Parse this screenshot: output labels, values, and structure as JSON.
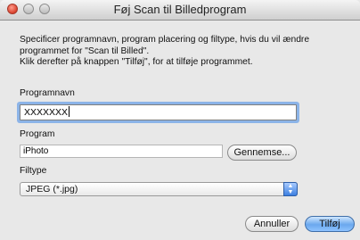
{
  "window": {
    "title": "Føj Scan til Billedprogram"
  },
  "instructions": {
    "line1": "Specificer programnavn, program placering og filtype, hvis du vil ændre",
    "line2": "programmet for \"Scan til Billed\".",
    "line3": "Klik derefter på knappen \"Tilføj\", for at tilføje programmet."
  },
  "program_name": {
    "label": "Programnavn",
    "value": "XXXXXXX"
  },
  "program": {
    "label": "Program",
    "value": "iPhoto",
    "browse_label": "Gennemse..."
  },
  "filetype": {
    "label": "Filtype",
    "selected": "JPEG (*.jpg)"
  },
  "buttons": {
    "cancel": "Annuller",
    "add": "Tilføj"
  }
}
